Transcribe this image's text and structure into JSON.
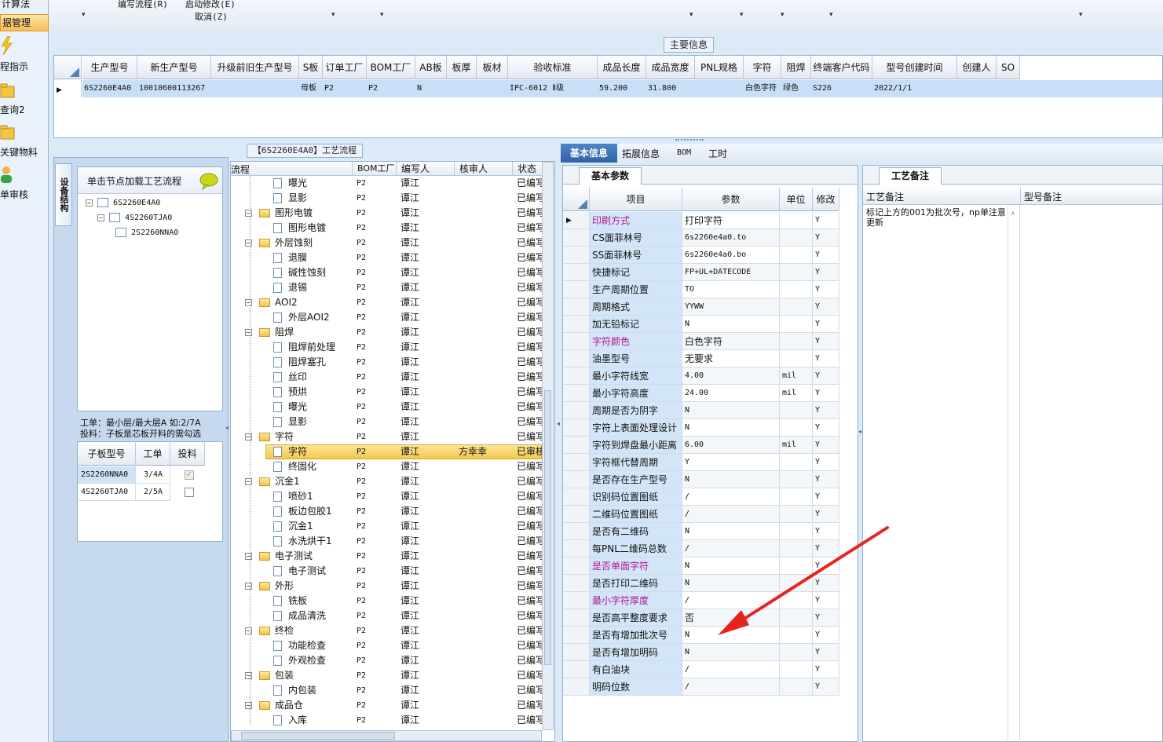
{
  "nav": {
    "items": [
      "计算法",
      "据管理",
      "程指示",
      "查询2",
      "关键物料",
      "单审核"
    ]
  },
  "toolbar": {
    "labels": [
      "编写流程(R)",
      "启动修改(E)",
      "取消(Z)"
    ]
  },
  "main_info": {
    "title": "主要信息",
    "columns": [
      "生产型号",
      "新生产型号",
      "升级前旧生产型号",
      "S板",
      "订单工厂",
      "BOM工厂",
      "AB板",
      "板厚",
      "板材",
      "验收标准",
      "成品长度",
      "成品宽度",
      "PNL规格",
      "字符",
      "阻焊",
      "终端客户代码",
      "型号创建时间",
      "创建人",
      "SO"
    ],
    "row": [
      "6S2260E4A0",
      "10010600113267",
      "",
      "母板",
      "P2",
      "P2",
      "N",
      "",
      "",
      "IPC-6012 Ⅱ级",
      "59.200",
      "31.800",
      "",
      "白色字符",
      "绿色",
      "S226",
      "2022/1/1",
      "",
      ""
    ]
  },
  "flow": {
    "title": "【6S2260E4A0】工艺流程"
  },
  "struct": {
    "tab": "设备结构",
    "hint": "单击节点加载工艺流程",
    "tree": [
      "6S2260E4A0",
      "4S2260TJA0",
      "2S2260NNA0"
    ],
    "note1": "工单：最小层/最大层A 如:2/7A",
    "note2": "投料：子板是芯板开料的需勾选",
    "sub_cols": [
      "子板型号",
      "工单",
      "投料"
    ],
    "sub_rows": [
      {
        "model": "2S2260NNA0",
        "order": "3/4A"
      },
      {
        "model": "4S2260TJA0",
        "order": "2/5A"
      }
    ]
  },
  "process": {
    "cols": [
      "流程",
      "BOM工厂",
      "编写人",
      "核审人",
      "状态"
    ],
    "rows": [
      {
        "n": "曝光",
        "l": 2,
        "f": 0,
        "b": "P2",
        "w": "谭江",
        "r": "",
        "s": "已编写"
      },
      {
        "n": "显影",
        "l": 2,
        "f": 0,
        "b": "P2",
        "w": "谭江",
        "r": "",
        "s": "已编写"
      },
      {
        "n": "图形电镀",
        "l": 1,
        "f": 1,
        "b": "P2",
        "w": "谭江",
        "r": "",
        "s": "已编写"
      },
      {
        "n": "图形电镀",
        "l": 2,
        "f": 0,
        "b": "P2",
        "w": "谭江",
        "r": "",
        "s": "已编写"
      },
      {
        "n": "外层蚀刻",
        "l": 1,
        "f": 1,
        "b": "P2",
        "w": "谭江",
        "r": "",
        "s": "已编写"
      },
      {
        "n": "退膜",
        "l": 2,
        "f": 0,
        "b": "P2",
        "w": "谭江",
        "r": "",
        "s": "已编写"
      },
      {
        "n": "碱性蚀刻",
        "l": 2,
        "f": 0,
        "b": "P2",
        "w": "谭江",
        "r": "",
        "s": "已编写"
      },
      {
        "n": "退锡",
        "l": 2,
        "f": 0,
        "b": "P2",
        "w": "谭江",
        "r": "",
        "s": "已编写"
      },
      {
        "n": "AOI2",
        "l": 1,
        "f": 1,
        "b": "P2",
        "w": "谭江",
        "r": "",
        "s": "已编写"
      },
      {
        "n": "外层AOI2",
        "l": 2,
        "f": 0,
        "b": "P2",
        "w": "谭江",
        "r": "",
        "s": "已编写"
      },
      {
        "n": "阻焊",
        "l": 1,
        "f": 1,
        "b": "P2",
        "w": "谭江",
        "r": "",
        "s": "已编写"
      },
      {
        "n": "阻焊前处理",
        "l": 2,
        "f": 0,
        "b": "P2",
        "w": "谭江",
        "r": "",
        "s": "已编写"
      },
      {
        "n": "阻焊塞孔",
        "l": 2,
        "f": 0,
        "b": "P2",
        "w": "谭江",
        "r": "",
        "s": "已编写"
      },
      {
        "n": "丝印",
        "l": 2,
        "f": 0,
        "b": "P2",
        "w": "谭江",
        "r": "",
        "s": "已编写"
      },
      {
        "n": "预烘",
        "l": 2,
        "f": 0,
        "b": "P2",
        "w": "谭江",
        "r": "",
        "s": "已编写"
      },
      {
        "n": "曝光",
        "l": 2,
        "f": 0,
        "b": "P2",
        "w": "谭江",
        "r": "",
        "s": "已编写"
      },
      {
        "n": "显影",
        "l": 2,
        "f": 0,
        "b": "P2",
        "w": "谭江",
        "r": "",
        "s": "已编写"
      },
      {
        "n": "字符",
        "l": 1,
        "f": 1,
        "b": "P2",
        "w": "谭江",
        "r": "",
        "s": "已编写"
      },
      {
        "n": "字符",
        "l": 2,
        "f": 0,
        "b": "P2",
        "w": "谭江",
        "r": "方幸幸",
        "s": "已审核",
        "sel": 1
      },
      {
        "n": "终固化",
        "l": 2,
        "f": 0,
        "b": "P2",
        "w": "谭江",
        "r": "",
        "s": "已编写"
      },
      {
        "n": "沉金1",
        "l": 1,
        "f": 1,
        "b": "P2",
        "w": "谭江",
        "r": "",
        "s": "已编写"
      },
      {
        "n": "喷砂1",
        "l": 2,
        "f": 0,
        "b": "P2",
        "w": "谭江",
        "r": "",
        "s": "已编写"
      },
      {
        "n": "板边包胶1",
        "l": 2,
        "f": 0,
        "b": "P2",
        "w": "谭江",
        "r": "",
        "s": "已编写"
      },
      {
        "n": "沉金1",
        "l": 2,
        "f": 0,
        "b": "P2",
        "w": "谭江",
        "r": "",
        "s": "已编写"
      },
      {
        "n": "水洗烘干1",
        "l": 2,
        "f": 0,
        "b": "P2",
        "w": "谭江",
        "r": "",
        "s": "已编写"
      },
      {
        "n": "电子测试",
        "l": 1,
        "f": 1,
        "b": "P2",
        "w": "谭江",
        "r": "",
        "s": "已编写"
      },
      {
        "n": "电子测试",
        "l": 2,
        "f": 0,
        "b": "P2",
        "w": "谭江",
        "r": "",
        "s": "已编写"
      },
      {
        "n": "外形",
        "l": 1,
        "f": 1,
        "b": "P2",
        "w": "谭江",
        "r": "",
        "s": "已编写"
      },
      {
        "n": "铣板",
        "l": 2,
        "f": 0,
        "b": "P2",
        "w": "谭江",
        "r": "",
        "s": "已编写"
      },
      {
        "n": "成品清洗",
        "l": 2,
        "f": 0,
        "b": "P2",
        "w": "谭江",
        "r": "",
        "s": "已编写"
      },
      {
        "n": "终检",
        "l": 1,
        "f": 1,
        "b": "P2",
        "w": "谭江",
        "r": "",
        "s": "已编写"
      },
      {
        "n": "功能检查",
        "l": 2,
        "f": 0,
        "b": "P2",
        "w": "谭江",
        "r": "",
        "s": "已编写"
      },
      {
        "n": "外观检查",
        "l": 2,
        "f": 0,
        "b": "P2",
        "w": "谭江",
        "r": "",
        "s": "已编写"
      },
      {
        "n": "包装",
        "l": 1,
        "f": 1,
        "b": "P2",
        "w": "谭江",
        "r": "",
        "s": "已编写"
      },
      {
        "n": "内包装",
        "l": 2,
        "f": 0,
        "b": "P2",
        "w": "谭江",
        "r": "",
        "s": "已编写"
      },
      {
        "n": "成品仓",
        "l": 1,
        "f": 1,
        "b": "P2",
        "w": "谭江",
        "r": "",
        "s": "已编写"
      },
      {
        "n": "入库",
        "l": 2,
        "f": 0,
        "b": "P2",
        "w": "谭江",
        "r": "",
        "s": "已编写"
      }
    ]
  },
  "tabs": [
    "基本信息",
    "拓展信息",
    "BOM",
    "工时"
  ],
  "basic": {
    "subtab": "基本参数",
    "cols": [
      "项目",
      "参数",
      "单位",
      "修改"
    ],
    "rows": [
      {
        "k": "印刷方式",
        "v": "打印字符",
        "u": "",
        "m": "Y",
        "pink": 1
      },
      {
        "k": "CS面菲林号",
        "v": "6s2260e4a0.to",
        "u": "",
        "m": "Y"
      },
      {
        "k": "SS面菲林号",
        "v": "6s2260e4a0.bo",
        "u": "",
        "m": "Y"
      },
      {
        "k": "快捷标记",
        "v": "FP+UL+DATECODE",
        "u": "",
        "m": "Y"
      },
      {
        "k": "生产周期位置",
        "v": "TO",
        "u": "",
        "m": "Y"
      },
      {
        "k": "周期格式",
        "v": "YYWW",
        "u": "",
        "m": "Y"
      },
      {
        "k": "加无铅标记",
        "v": "N",
        "u": "",
        "m": "Y"
      },
      {
        "k": "字符颜色",
        "v": "白色字符",
        "u": "",
        "m": "Y",
        "pink": 1
      },
      {
        "k": "油墨型号",
        "v": "无要求",
        "u": "",
        "m": "Y"
      },
      {
        "k": "最小字符线宽",
        "v": "4.00",
        "u": "mil",
        "m": "Y"
      },
      {
        "k": "最小字符高度",
        "v": "24.00",
        "u": "mil",
        "m": "Y"
      },
      {
        "k": "周期是否为阴字",
        "v": "N",
        "u": "",
        "m": "Y"
      },
      {
        "k": "字符上表面处理设计",
        "v": "N",
        "u": "",
        "m": "Y"
      },
      {
        "k": "字符到焊盘最小距离",
        "v": "6.00",
        "u": "mil",
        "m": "Y"
      },
      {
        "k": "字符框代替周期",
        "v": "Y",
        "u": "",
        "m": "Y"
      },
      {
        "k": "是否存在生产型号",
        "v": "N",
        "u": "",
        "m": "Y"
      },
      {
        "k": "识别码位置图纸",
        "v": "/",
        "u": "",
        "m": "Y"
      },
      {
        "k": "二维码位置图纸",
        "v": "/",
        "u": "",
        "m": "Y"
      },
      {
        "k": "是否有二维码",
        "v": "N",
        "u": "",
        "m": "Y"
      },
      {
        "k": "每PNL二维码总数",
        "v": "/",
        "u": "",
        "m": "Y"
      },
      {
        "k": "是否单面字符",
        "v": "N",
        "u": "",
        "m": "Y",
        "pink": 1
      },
      {
        "k": "是否打印二维码",
        "v": "N",
        "u": "",
        "m": "Y"
      },
      {
        "k": "最小字符厚度",
        "v": "/",
        "u": "",
        "m": "Y",
        "pink": 1
      },
      {
        "k": "是否高平整度要求",
        "v": "否",
        "u": "",
        "m": "Y"
      },
      {
        "k": "是否有增加批次号",
        "v": "N",
        "u": "",
        "m": "Y"
      },
      {
        "k": "是否有增加明码",
        "v": "N",
        "u": "",
        "m": "Y"
      },
      {
        "k": "有白油块",
        "v": "/",
        "u": "",
        "m": "Y"
      },
      {
        "k": "明码位数",
        "v": "/",
        "u": "",
        "m": "Y"
      }
    ]
  },
  "remark": {
    "tab": "工艺备注",
    "col1": "工艺备注",
    "col2": "型号备注",
    "text": "标记上方的001为批次号，np单注意更新"
  },
  "colors": {
    "pink": "#b0188c",
    "selected": "#f8d45c",
    "header": "#e4ebf3",
    "arrow": "#e8231f"
  }
}
